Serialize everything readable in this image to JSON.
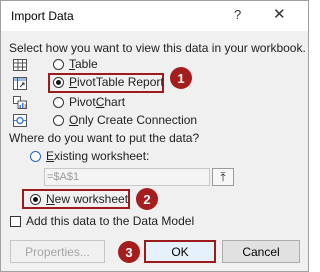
{
  "window": {
    "title": "Import Data",
    "help_glyph": "?",
    "close_glyph": "✕"
  },
  "prompt_view": "Select how you want to view this data in your workbook.",
  "view_options": [
    {
      "label": "Table",
      "mnemonic": "T",
      "rest": "able",
      "selected": false,
      "icon": "table-icon"
    },
    {
      "label": "PivotTable Report",
      "mnemonic": "P",
      "rest": "ivotTable Report",
      "selected": true,
      "icon": "pivottable-icon"
    },
    {
      "label": "PivotChart",
      "prefix": "Pivot",
      "mnemonic": "C",
      "rest": "hart",
      "selected": false,
      "icon": "pivotchart-icon"
    },
    {
      "label": "Only Create Connection",
      "mnemonic": "O",
      "rest": "nly Create Connection",
      "selected": false,
      "icon": "connection-icon"
    }
  ],
  "prompt_location": "Where do you want to put the data?",
  "location_options": {
    "existing": {
      "label": "Existing worksheet:",
      "mnemonic": "E",
      "rest": "xisting worksheet:",
      "selected": false
    },
    "new": {
      "label": "New worksheet",
      "mnemonic": "N",
      "rest": "ew worksheet",
      "selected": true
    }
  },
  "range_input": {
    "value": "=$A$1",
    "collapse_glyph": "⤒"
  },
  "data_model_checkbox": {
    "label": "Add this data to the Data Model",
    "checked": false
  },
  "buttons": {
    "properties": "Properties...",
    "ok": "OK",
    "cancel": "Cancel"
  },
  "steps": [
    "1",
    "2",
    "3"
  ],
  "colors": {
    "accent_red": "#a51d1d",
    "radio_blue": "#2a63b8"
  }
}
